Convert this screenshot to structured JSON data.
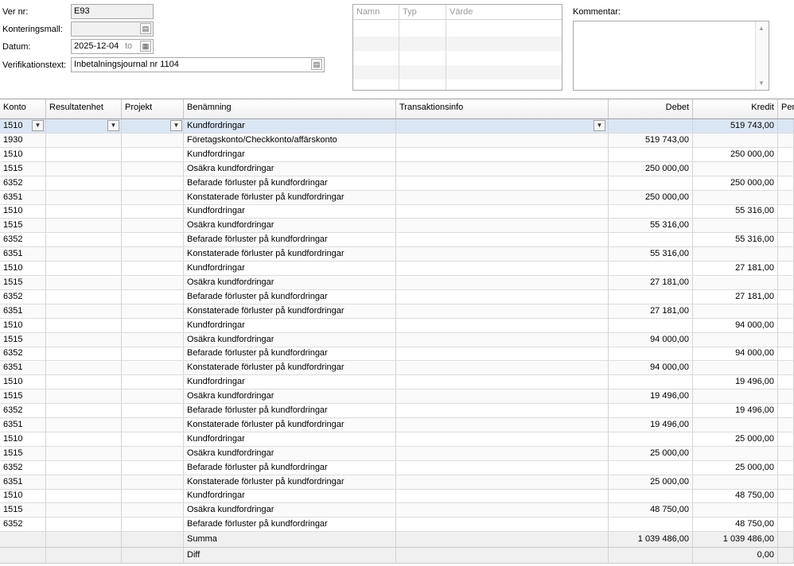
{
  "header": {
    "ver_nr_label": "Ver nr:",
    "ver_nr_value": "E93",
    "konteringsmall_label": "Konteringsmall:",
    "konteringsmall_value": "",
    "datum_label": "Datum:",
    "datum_value": "2025-12-04",
    "datum_to": "to",
    "verifikationstext_label": "Verifikationstext:",
    "verifikationstext_value": "Inbetalningsjournal nr 1104",
    "kommentar_label": "Kommentar:"
  },
  "attributes_grid": {
    "columns": [
      "Namn",
      "Typ",
      "Värde"
    ]
  },
  "grid": {
    "columns": [
      "Konto",
      "Resultatenhet",
      "Projekt",
      "Benämning",
      "Transaktionsinfo",
      "Debet",
      "Kredit",
      "Peri"
    ],
    "rows": [
      {
        "konto": "1510",
        "benamning": "Kundfordringar",
        "debet": "",
        "kredit": "519 743,00"
      },
      {
        "konto": "1930",
        "benamning": "Företagskonto/Checkkonto/affärskonto",
        "debet": "519 743,00",
        "kredit": ""
      },
      {
        "konto": "1510",
        "benamning": "Kundfordringar",
        "debet": "",
        "kredit": "250 000,00"
      },
      {
        "konto": "1515",
        "benamning": "Osäkra kundfordringar",
        "debet": "250 000,00",
        "kredit": ""
      },
      {
        "konto": "6352",
        "benamning": "Befarade förluster på kundfordringar",
        "debet": "",
        "kredit": "250 000,00"
      },
      {
        "konto": "6351",
        "benamning": "Konstaterade förluster på kundfordringar",
        "debet": "250 000,00",
        "kredit": ""
      },
      {
        "konto": "1510",
        "benamning": "Kundfordringar",
        "debet": "",
        "kredit": "55 316,00"
      },
      {
        "konto": "1515",
        "benamning": "Osäkra kundfordringar",
        "debet": "55 316,00",
        "kredit": ""
      },
      {
        "konto": "6352",
        "benamning": "Befarade förluster på kundfordringar",
        "debet": "",
        "kredit": "55 316,00"
      },
      {
        "konto": "6351",
        "benamning": "Konstaterade förluster på kundfordringar",
        "debet": "55 316,00",
        "kredit": ""
      },
      {
        "konto": "1510",
        "benamning": "Kundfordringar",
        "debet": "",
        "kredit": "27 181,00"
      },
      {
        "konto": "1515",
        "benamning": "Osäkra kundfordringar",
        "debet": "27 181,00",
        "kredit": ""
      },
      {
        "konto": "6352",
        "benamning": "Befarade förluster på kundfordringar",
        "debet": "",
        "kredit": "27 181,00"
      },
      {
        "konto": "6351",
        "benamning": "Konstaterade förluster på kundfordringar",
        "debet": "27 181,00",
        "kredit": ""
      },
      {
        "konto": "1510",
        "benamning": "Kundfordringar",
        "debet": "",
        "kredit": "94 000,00"
      },
      {
        "konto": "1515",
        "benamning": "Osäkra kundfordringar",
        "debet": "94 000,00",
        "kredit": ""
      },
      {
        "konto": "6352",
        "benamning": "Befarade förluster på kundfordringar",
        "debet": "",
        "kredit": "94 000,00"
      },
      {
        "konto": "6351",
        "benamning": "Konstaterade förluster på kundfordringar",
        "debet": "94 000,00",
        "kredit": ""
      },
      {
        "konto": "1510",
        "benamning": "Kundfordringar",
        "debet": "",
        "kredit": "19 496,00"
      },
      {
        "konto": "1515",
        "benamning": "Osäkra kundfordringar",
        "debet": "19 496,00",
        "kredit": ""
      },
      {
        "konto": "6352",
        "benamning": "Befarade förluster på kundfordringar",
        "debet": "",
        "kredit": "19 496,00"
      },
      {
        "konto": "6351",
        "benamning": "Konstaterade förluster på kundfordringar",
        "debet": "19 496,00",
        "kredit": ""
      },
      {
        "konto": "1510",
        "benamning": "Kundfordringar",
        "debet": "",
        "kredit": "25 000,00"
      },
      {
        "konto": "1515",
        "benamning": "Osäkra kundfordringar",
        "debet": "25 000,00",
        "kredit": ""
      },
      {
        "konto": "6352",
        "benamning": "Befarade förluster på kundfordringar",
        "debet": "",
        "kredit": "25 000,00"
      },
      {
        "konto": "6351",
        "benamning": "Konstaterade förluster på kundfordringar",
        "debet": "25 000,00",
        "kredit": ""
      },
      {
        "konto": "1510",
        "benamning": "Kundfordringar",
        "debet": "",
        "kredit": "48 750,00"
      },
      {
        "konto": "1515",
        "benamning": "Osäkra kundfordringar",
        "debet": "48 750,00",
        "kredit": ""
      },
      {
        "konto": "6352",
        "benamning": "Befarade förluster på kundfordringar",
        "debet": "",
        "kredit": "48 750,00"
      }
    ],
    "summa_label": "Summa",
    "summa_debet": "1 039 486,00",
    "summa_kredit": "1 039 486,00",
    "diff_label": "Diff",
    "diff_value": "0,00"
  }
}
